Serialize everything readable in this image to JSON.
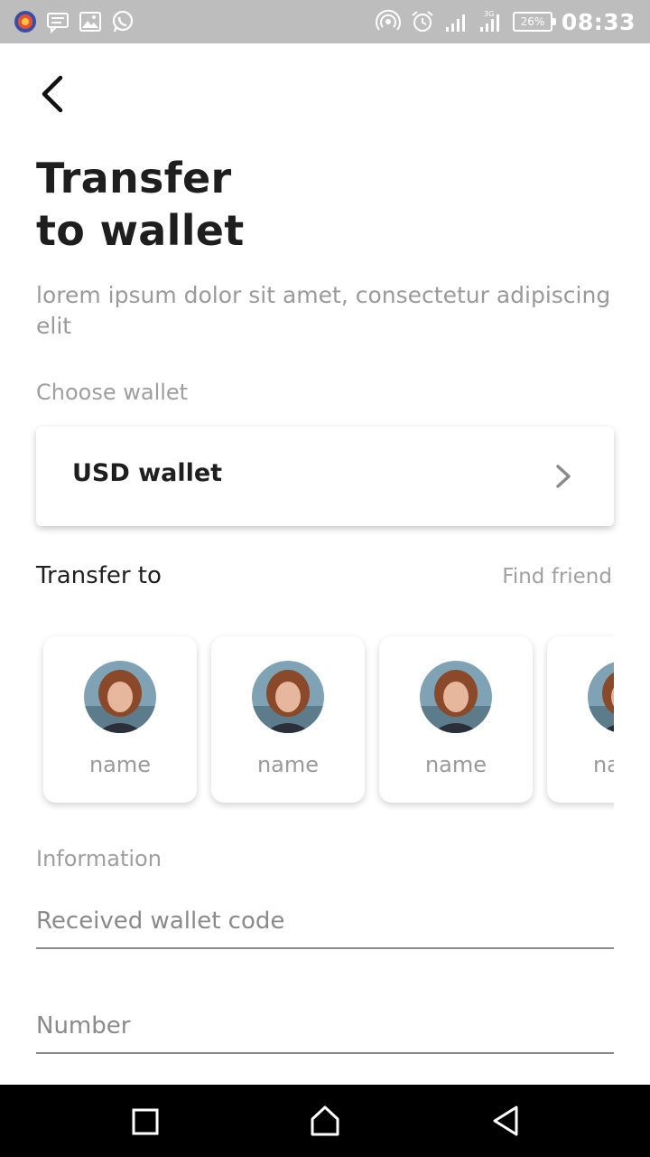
{
  "status_bar": {
    "left_icons": [
      "browser-app-icon",
      "message-icon",
      "gallery-icon",
      "whatsapp-icon"
    ],
    "right_icons": [
      "hotspot-icon",
      "alarm-icon",
      "signal-icon",
      "signal-3g-icon"
    ],
    "battery": "26%",
    "time": "08:33"
  },
  "header": {
    "title_line1": "Transfer",
    "title_line2": "to wallet",
    "subtitle": "lorem ipsum dolor sit amet, consectetur adipiscing elit"
  },
  "wallet": {
    "section_label": "Choose wallet",
    "selected": "USD wallet"
  },
  "transfer": {
    "heading": "Transfer to",
    "find_friend": "Find friend",
    "friends": [
      {
        "name": "name"
      },
      {
        "name": "name"
      },
      {
        "name": "name"
      },
      {
        "name": "name"
      }
    ]
  },
  "information": {
    "section_label": "Information",
    "wallet_code_placeholder": "Received wallet code",
    "number_placeholder": "Number"
  },
  "nav_bar": {
    "buttons": [
      "recents-icon",
      "home-icon",
      "back-triangle-icon"
    ]
  },
  "colors": {
    "status_bar": "#bdbdbd",
    "title": "#1e1e1e",
    "muted_text": "#9a9a9a",
    "nav_bar": "#000000"
  }
}
